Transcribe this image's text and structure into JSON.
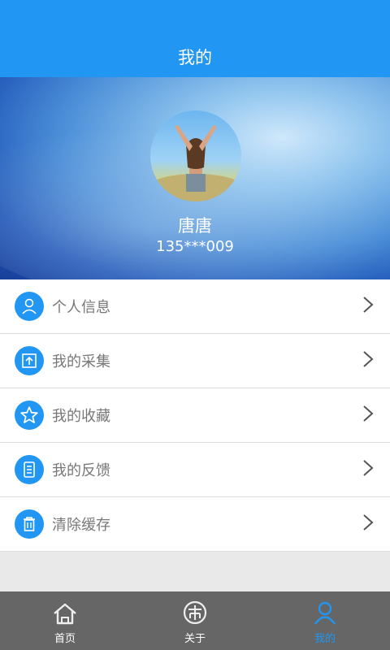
{
  "header": {
    "title": "我的"
  },
  "profile": {
    "name": "唐唐",
    "phone": "135***009"
  },
  "menu": [
    {
      "label": "个人信息",
      "icon": "person-icon"
    },
    {
      "label": "我的采集",
      "icon": "upload-icon"
    },
    {
      "label": "我的收藏",
      "icon": "star-icon"
    },
    {
      "label": "我的反馈",
      "icon": "document-icon"
    },
    {
      "label": "清除缓存",
      "icon": "trash-icon"
    }
  ],
  "tabs": [
    {
      "label": "首页",
      "icon": "home-icon",
      "active": false
    },
    {
      "label": "关于",
      "icon": "info-logo-icon",
      "active": false
    },
    {
      "label": "我的",
      "icon": "user-icon",
      "active": true
    }
  ],
  "colors": {
    "primary": "#2196f3",
    "tabbar": "#666666"
  }
}
